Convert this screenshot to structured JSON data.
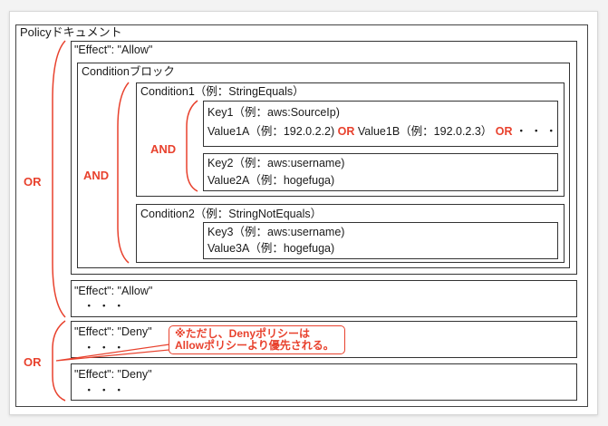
{
  "policy_title": "Policyドキュメント",
  "effect_allow_1": "\"Effect\": \"Allow\"",
  "condition_block_title": "Conditionブロック",
  "condition1": {
    "title": "Condition1（例：StringEquals）",
    "key1": "Key1（例：aws:SourceIp)",
    "value1a": "Value1A（例：192.0.2.2)",
    "or1": "OR",
    "value1b": "Value1B（例：192.0.2.3）",
    "or2": "OR",
    "dots": "・・・",
    "key2": "Key2（例：aws:username)",
    "value2a": "Value2A（例：hogefuga)"
  },
  "condition2": {
    "title": "Condition2（例：StringNotEquals）",
    "key3": "Key3（例：aws:username)",
    "value3a": "Value3A（例：hogefuga)"
  },
  "and_inner": "AND",
  "and_outer": "AND",
  "or_top": "OR",
  "effect_allow_2": "\"Effect\": \"Allow\"",
  "effect_allow_2_dots": "・・・",
  "effect_deny_1": "\"Effect\": \"Deny\"",
  "effect_deny_1_dots": "・・・",
  "callout_line1": "※ただし、Denyポリシーは",
  "callout_line2": "Allowポリシーより優先される。",
  "or_bottom": "OR",
  "effect_deny_2": "\"Effect\": \"Deny\"",
  "effect_deny_2_dots": "・・・",
  "colors": {
    "accent": "#e8412d",
    "border": "#333333"
  }
}
